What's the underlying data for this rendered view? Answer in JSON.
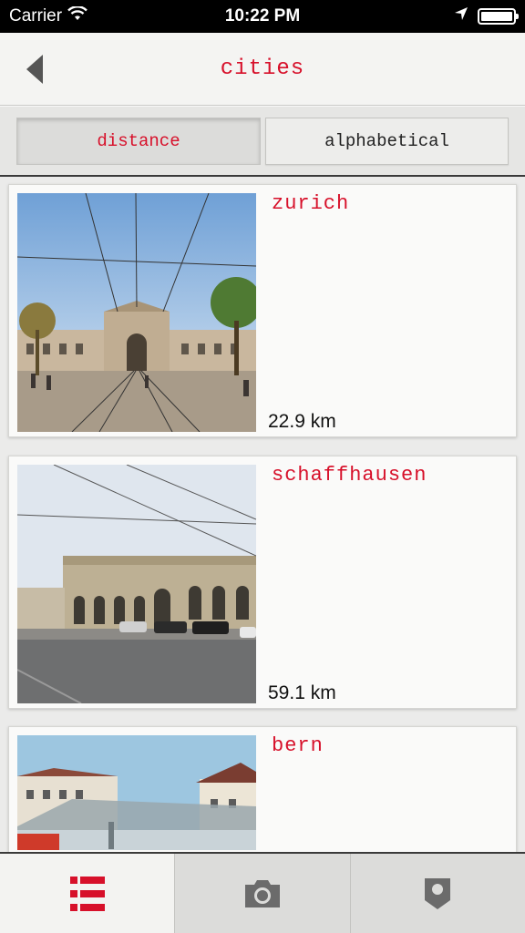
{
  "status_bar": {
    "carrier": "Carrier",
    "time": "10:22 PM"
  },
  "nav": {
    "title": "cities"
  },
  "sort": {
    "distance_label": "distance",
    "alphabetical_label": "alphabetical",
    "selected": "distance"
  },
  "cities": [
    {
      "name": "zurich",
      "distance": "22.9 km"
    },
    {
      "name": "schaffhausen",
      "distance": "59.1 km"
    },
    {
      "name": "bern",
      "distance": ""
    }
  ],
  "tabs": [
    {
      "icon": "list-icon",
      "active": true
    },
    {
      "icon": "camera-icon",
      "active": false
    },
    {
      "icon": "map-pin-icon",
      "active": false
    }
  ],
  "colors": {
    "accent": "#d7102a",
    "status_bar_bg": "#000000",
    "background": "#ebebea"
  }
}
